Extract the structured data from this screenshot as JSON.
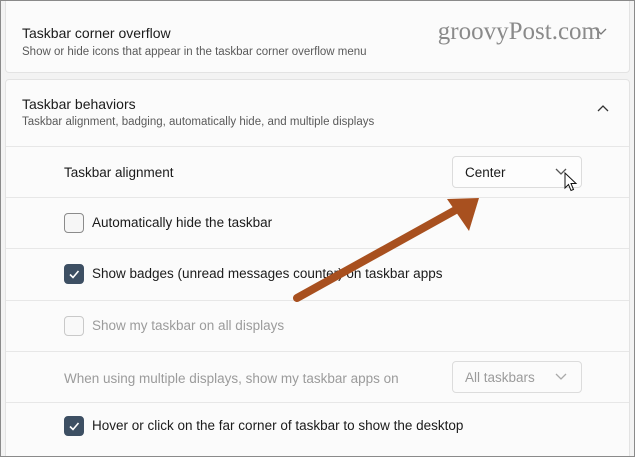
{
  "overflow_section": {
    "title": "Taskbar corner overflow",
    "subtitle": "Show or hide icons that appear in the taskbar corner overflow menu"
  },
  "watermark": "groovyPost.com",
  "behaviors_section": {
    "title": "Taskbar behaviors",
    "subtitle": "Taskbar alignment, badging, automatically hide, and multiple displays",
    "alignment": {
      "label": "Taskbar alignment",
      "value": "Center"
    },
    "auto_hide": {
      "label": "Automatically hide the taskbar",
      "checked": false
    },
    "badges": {
      "label": "Show badges (unread messages counter) on taskbar apps",
      "checked": true
    },
    "all_displays": {
      "label": "Show my taskbar on all displays",
      "checked": false,
      "disabled": true
    },
    "multi_display": {
      "label": "When using multiple displays, show my taskbar apps on",
      "value": "All taskbars",
      "disabled": true
    },
    "far_corner": {
      "label": "Hover or click on the far corner of taskbar to show the desktop",
      "checked": true
    }
  },
  "colors": {
    "accent": "#3d4f63",
    "arrow": "#a8501f"
  },
  "icons": {
    "expand": "chevron-down-icon",
    "collapse": "chevron-up-icon",
    "annotation": "arrow-annotation",
    "pointer": "mouse-cursor-icon"
  }
}
